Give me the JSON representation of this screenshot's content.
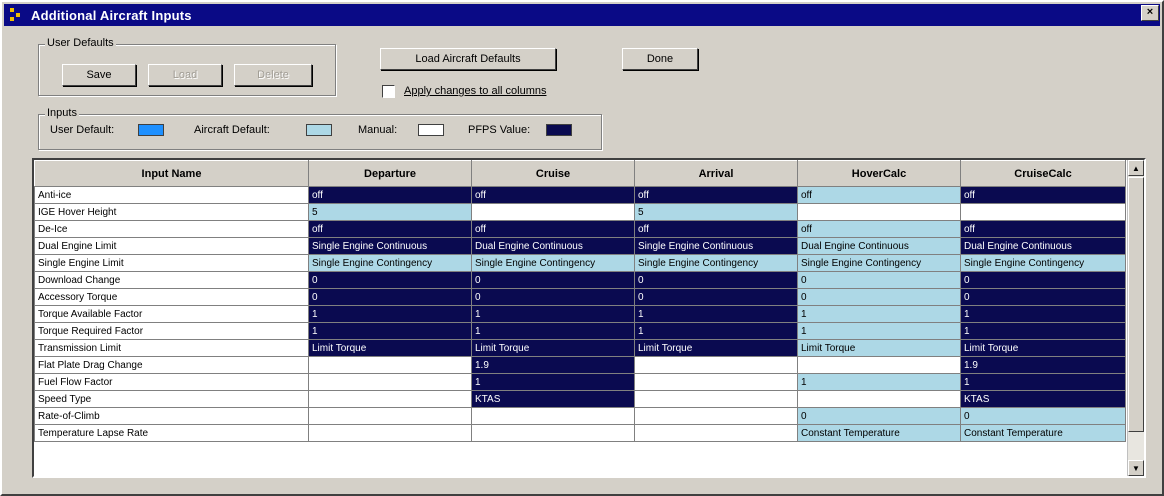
{
  "window": {
    "title": "Additional Aircraft Inputs",
    "close_glyph": "×"
  },
  "user_defaults": {
    "label": "User Defaults",
    "buttons": [
      "Save",
      "Load",
      "Delete"
    ]
  },
  "toolbar": {
    "load_aircraft_defaults": "Load Aircraft Defaults",
    "done": "Done",
    "apply_all_label": "Apply changes to all columns",
    "apply_all_checked": false
  },
  "inputs_legend": {
    "label": "Inputs",
    "items": [
      {
        "label": "User Default:",
        "color": "#1e90ff"
      },
      {
        "label": "Aircraft Default:",
        "color": "#add8e6"
      },
      {
        "label": "Manual:",
        "color": "#ffffff"
      },
      {
        "label": "PFPS Value:",
        "color": "#0a0a50"
      }
    ]
  },
  "grid": {
    "columns": [
      "Input Name",
      "Departure",
      "Cruise",
      "Arrival",
      "HoverCalc",
      "CruiseCalc"
    ],
    "rows": [
      {
        "name": "Anti-ice",
        "cells": [
          [
            "off",
            "user"
          ],
          [
            "off",
            "user"
          ],
          [
            "off",
            "user"
          ],
          [
            "off",
            "aircraft"
          ],
          [
            "off",
            "user"
          ]
        ]
      },
      {
        "name": "IGE Hover Height",
        "cells": [
          [
            "5",
            "aircraft"
          ],
          [
            "",
            "blank"
          ],
          [
            "5",
            "aircraft"
          ],
          [
            "",
            "blank"
          ],
          [
            "",
            "blank"
          ]
        ]
      },
      {
        "name": "De-Ice",
        "cells": [
          [
            "off",
            "user"
          ],
          [
            "off",
            "user"
          ],
          [
            "off",
            "user"
          ],
          [
            "off",
            "aircraft"
          ],
          [
            "off",
            "user"
          ]
        ]
      },
      {
        "name": "Dual Engine Limit",
        "cells": [
          [
            "Single Engine Continuous",
            "user"
          ],
          [
            "Dual Engine Continuous",
            "user"
          ],
          [
            "Single Engine Continuous",
            "user"
          ],
          [
            "Dual Engine Continuous",
            "aircraft"
          ],
          [
            "Dual Engine Continuous",
            "user"
          ]
        ]
      },
      {
        "name": "Single Engine Limit",
        "cells": [
          [
            "Single Engine Contingency",
            "aircraft"
          ],
          [
            "Single Engine Contingency",
            "aircraft"
          ],
          [
            "Single Engine Contingency",
            "aircraft"
          ],
          [
            "Single Engine Contingency",
            "aircraft"
          ],
          [
            "Single Engine Contingency",
            "aircraft"
          ]
        ]
      },
      {
        "name": "Download Change",
        "cells": [
          [
            "0",
            "user"
          ],
          [
            "0",
            "user"
          ],
          [
            "0",
            "user"
          ],
          [
            "0",
            "aircraft"
          ],
          [
            "0",
            "user"
          ]
        ]
      },
      {
        "name": "Accessory Torque",
        "cells": [
          [
            "0",
            "user"
          ],
          [
            "0",
            "user"
          ],
          [
            "0",
            "user"
          ],
          [
            "0",
            "aircraft"
          ],
          [
            "0",
            "user"
          ]
        ]
      },
      {
        "name": "Torque Available Factor",
        "cells": [
          [
            "1",
            "user"
          ],
          [
            "1",
            "user"
          ],
          [
            "1",
            "user"
          ],
          [
            "1",
            "aircraft"
          ],
          [
            "1",
            "user"
          ]
        ]
      },
      {
        "name": "Torque Required Factor",
        "cells": [
          [
            "1",
            "user"
          ],
          [
            "1",
            "user"
          ],
          [
            "1",
            "user"
          ],
          [
            "1",
            "aircraft"
          ],
          [
            "1",
            "user"
          ]
        ]
      },
      {
        "name": "Transmission Limit",
        "cells": [
          [
            "Limit Torque",
            "user"
          ],
          [
            "Limit Torque",
            "user"
          ],
          [
            "Limit Torque",
            "user"
          ],
          [
            "Limit Torque",
            "aircraft"
          ],
          [
            "Limit Torque",
            "user"
          ]
        ]
      },
      {
        "name": "Flat Plate Drag Change",
        "cells": [
          [
            "",
            "blank"
          ],
          [
            "1.9",
            "user"
          ],
          [
            "",
            "blank"
          ],
          [
            "",
            "blank"
          ],
          [
            "1.9",
            "user"
          ]
        ]
      },
      {
        "name": "Fuel Flow Factor",
        "cells": [
          [
            "",
            "blank"
          ],
          [
            "1",
            "user"
          ],
          [
            "",
            "blank"
          ],
          [
            "1",
            "aircraft"
          ],
          [
            "1",
            "user"
          ]
        ]
      },
      {
        "name": "Speed Type",
        "cells": [
          [
            "",
            "blank"
          ],
          [
            "KTAS",
            "user"
          ],
          [
            "",
            "blank"
          ],
          [
            "",
            "blank"
          ],
          [
            "KTAS",
            "user"
          ]
        ]
      },
      {
        "name": "Rate-of-Climb",
        "cells": [
          [
            "",
            "blank"
          ],
          [
            "",
            "blank"
          ],
          [
            "",
            "blank"
          ],
          [
            "0",
            "aircraft"
          ],
          [
            "0",
            "aircraft"
          ]
        ]
      },
      {
        "name": "Temperature Lapse Rate",
        "cells": [
          [
            "",
            "blank"
          ],
          [
            "",
            "blank"
          ],
          [
            "",
            "blank"
          ],
          [
            "Constant Temperature",
            "aircraft"
          ],
          [
            "Constant Temperature",
            "aircraft"
          ]
        ]
      }
    ]
  }
}
